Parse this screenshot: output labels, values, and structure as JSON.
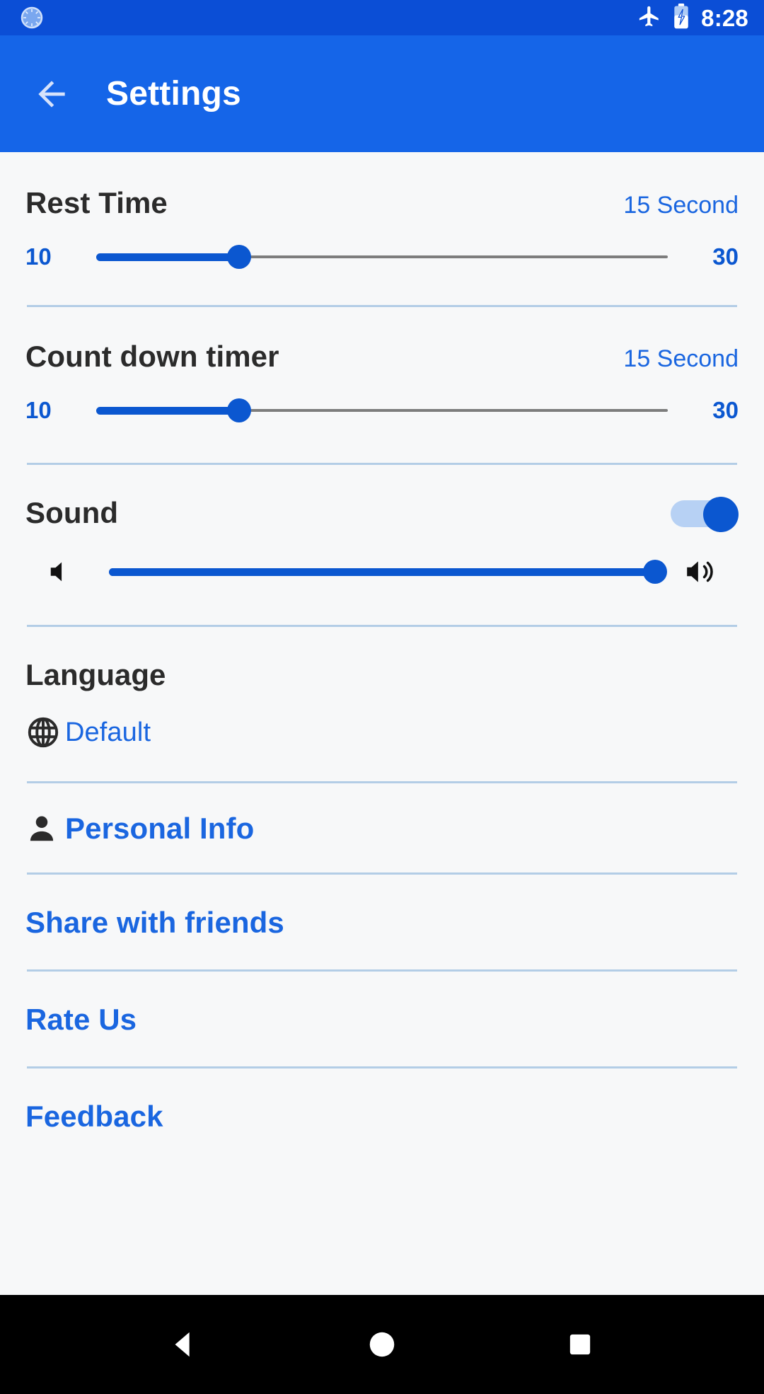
{
  "status_bar": {
    "notification_icon": "timer-notification-icon",
    "airplane_icon": "airplane-mode-icon",
    "battery_icon": "battery-charging-icon",
    "clock": "8:28",
    "background_color": "#0b4ed6"
  },
  "app_bar": {
    "back_icon": "back-arrow-icon",
    "title": "Settings",
    "background_color": "#1565e8"
  },
  "theme": {
    "accent": "#1a66e0",
    "slider_blue": "#0b57d0",
    "divider": "#b3cde6",
    "content_bg": "#f7f8f9",
    "heading": "#2b2b2b"
  },
  "settings": {
    "rest_time": {
      "title": "Rest Time",
      "value_label": "15 Second",
      "min_label": "10",
      "max_label": "30",
      "min": 10,
      "max": 30,
      "value": 15,
      "percent": 25
    },
    "count_down_timer": {
      "title": "Count down timer",
      "value_label": "15 Second",
      "min_label": "10",
      "max_label": "30",
      "min": 10,
      "max": 30,
      "value": 15,
      "percent": 25
    },
    "sound": {
      "title": "Sound",
      "toggle_state": "on",
      "volume": {
        "min_icon": "volume-mute-icon",
        "max_icon": "volume-up-icon",
        "min": 0,
        "max": 100,
        "value": 100,
        "percent": 100
      }
    },
    "language": {
      "title": "Language",
      "icon": "globe-icon",
      "selected": "Default"
    },
    "links": [
      {
        "label": "Personal Info",
        "icon": "person-icon"
      },
      {
        "label": "Share with friends",
        "icon": ""
      },
      {
        "label": "Rate Us",
        "icon": ""
      },
      {
        "label": "Feedback",
        "icon": ""
      }
    ]
  },
  "nav_bar": {
    "back": "nav-back-icon",
    "home": "nav-home-icon",
    "recents": "nav-recents-icon"
  }
}
